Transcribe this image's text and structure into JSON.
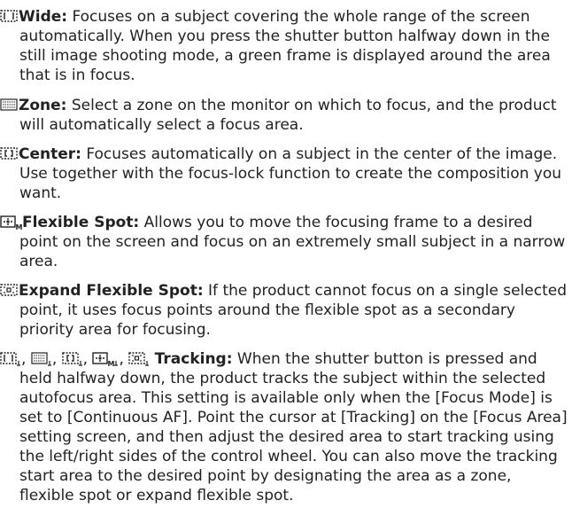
{
  "entries": [
    {
      "icon": "wide-area-icon",
      "name": "Wide:",
      "text": " Focuses on a subject covering the whole range of the screen automatically. When you press the shutter button halfway down in the still image shooting mode, a green frame is displayed around the area that is in focus."
    },
    {
      "icon": "zone-area-icon",
      "name": "Zone:",
      "text": " Select a zone on the monitor on which to focus, and the product will automatically select a focus area."
    },
    {
      "icon": "center-area-icon",
      "name": "Center:",
      "text": " Focuses automatically on a subject in the center of the image. Use together with the focus-lock function to create the composition you want."
    },
    {
      "icon": "flexible-spot-icon",
      "name": "Flexible Spot:",
      "text": " Allows you to move the focusing frame to a desired point on the screen and focus on an extremely small subject in a narrow area."
    },
    {
      "icon": "expand-flexible-spot-icon",
      "name": "Expand Flexible Spot:",
      "text": " If the product cannot focus on a single selected point, it uses focus points around the flexible spot as a secondary priority area for focusing."
    },
    {
      "icon": "tracking-icons",
      "separator": ",",
      "name": "Tracking:",
      "text": " When the shutter button is pressed and held halfway down, the product tracks the subject within the selected autofocus area. This setting is available only when the [Focus Mode] is set to [Continuous AF]. Point the cursor at [Tracking] on the [Focus Area] setting screen, and then adjust the desired area to start tracking using the left/right sides of the control wheel. You can also move the tracking start area to the desired point by designating the area as a zone, flexible spot or expand flexible spot."
    }
  ],
  "colors": {
    "text": "#222222",
    "icon": "#222222"
  }
}
